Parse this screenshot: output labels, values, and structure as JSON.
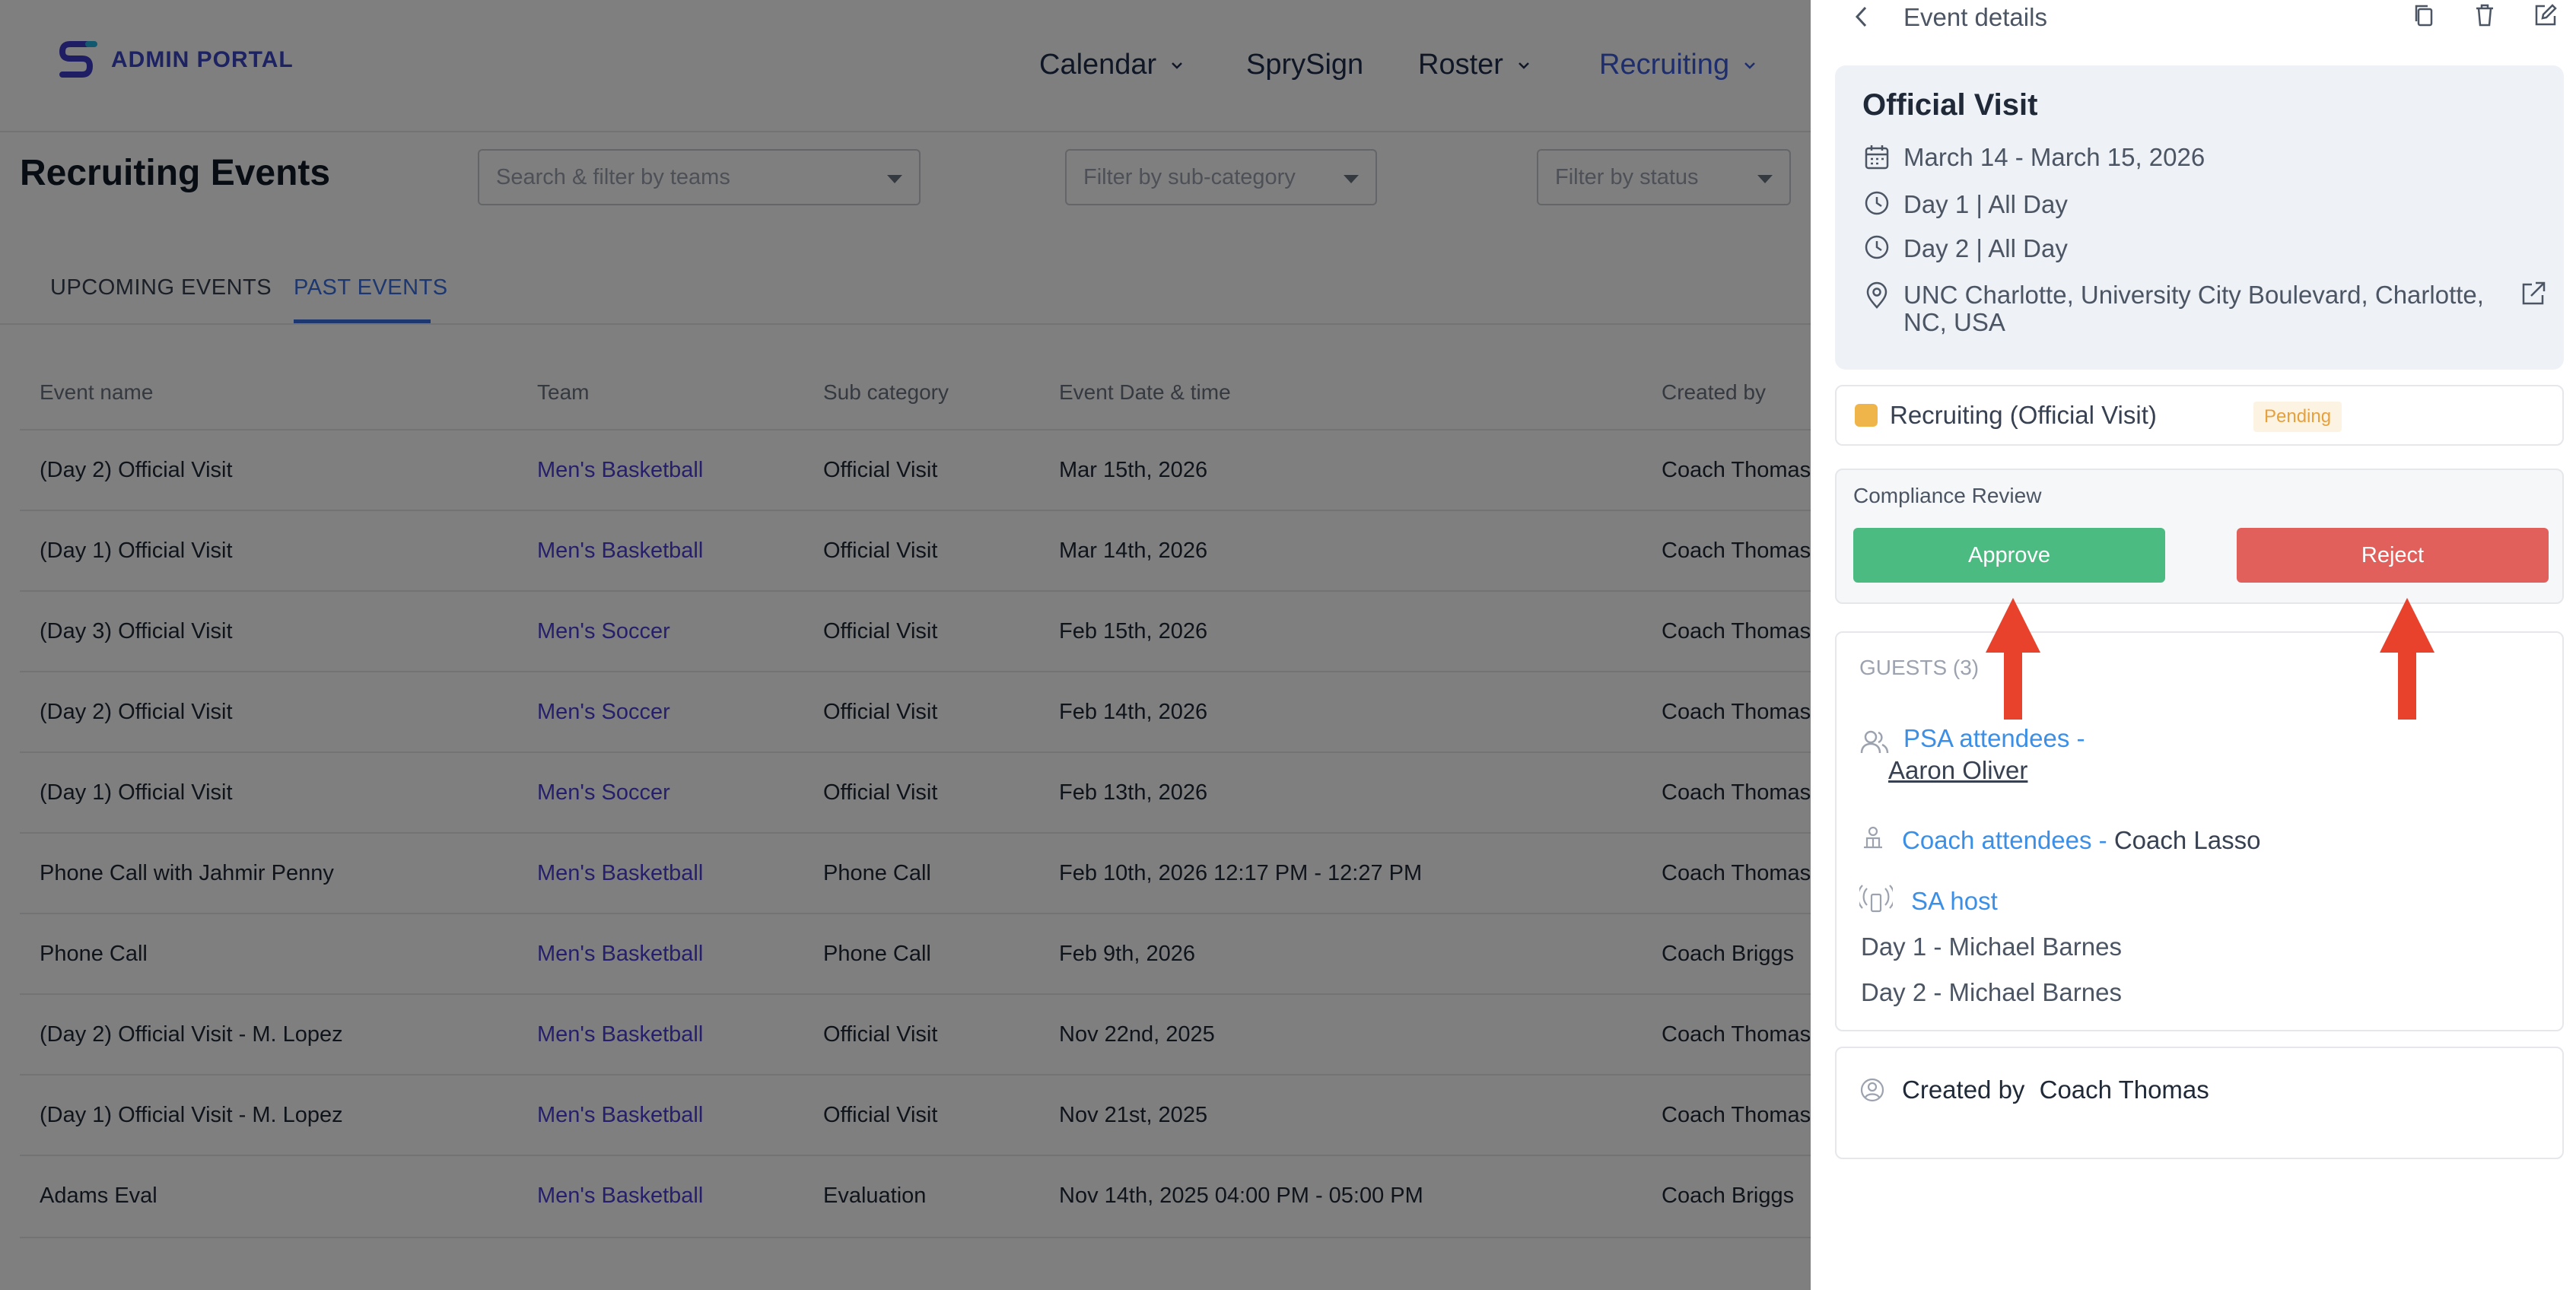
{
  "app": {
    "brand": "ADMIN PORTAL"
  },
  "nav": {
    "items": [
      {
        "label": "Calendar",
        "has_menu": true
      },
      {
        "label": "SprySign",
        "has_menu": false
      },
      {
        "label": "Roster",
        "has_menu": true
      },
      {
        "label": "Recruiting",
        "has_menu": true,
        "active": true
      }
    ]
  },
  "page": {
    "title": "Recruiting Events",
    "filters": {
      "teams_placeholder": "Search & filter by teams",
      "subcategory_placeholder": "Filter by sub-category",
      "status_placeholder": "Filter by status"
    },
    "tabs": [
      {
        "label": "UPCOMING EVENTS",
        "active": false
      },
      {
        "label": "PAST EVENTS",
        "active": true
      }
    ]
  },
  "table": {
    "headers": [
      "Event name",
      "Team",
      "Sub category",
      "Event Date & time",
      "Created by"
    ],
    "rows": [
      {
        "name": "(Day 2) Official Visit",
        "team": "Men's Basketball",
        "sub": "Official Visit",
        "date": "Mar 15th, 2026",
        "by": "Coach Thomas"
      },
      {
        "name": "(Day 1) Official Visit",
        "team": "Men's Basketball",
        "sub": "Official Visit",
        "date": "Mar 14th, 2026",
        "by": "Coach Thomas"
      },
      {
        "name": "(Day 3) Official Visit",
        "team": "Men's Soccer",
        "sub": "Official Visit",
        "date": "Feb 15th, 2026",
        "by": "Coach Thomas"
      },
      {
        "name": "(Day 2) Official Visit",
        "team": "Men's Soccer",
        "sub": "Official Visit",
        "date": "Feb 14th, 2026",
        "by": "Coach Thomas"
      },
      {
        "name": "(Day 1) Official Visit",
        "team": "Men's Soccer",
        "sub": "Official Visit",
        "date": "Feb 13th, 2026",
        "by": "Coach Thomas"
      },
      {
        "name": "Phone Call with Jahmir Penny",
        "team": "Men's Basketball",
        "sub": "Phone Call",
        "date": "Feb 10th, 2026 12:17 PM - 12:27 PM",
        "by": "Coach Thomas"
      },
      {
        "name": "Phone Call",
        "team": "Men's Basketball",
        "sub": "Phone Call",
        "date": "Feb 9th, 2026",
        "by": "Coach Briggs"
      },
      {
        "name": "(Day 2) Official Visit - M. Lopez",
        "team": "Men's Basketball",
        "sub": "Official Visit",
        "date": "Nov 22nd, 2025",
        "by": "Coach Thomas"
      },
      {
        "name": "(Day 1) Official Visit - M. Lopez",
        "team": "Men's Basketball",
        "sub": "Official Visit",
        "date": "Nov 21st, 2025",
        "by": "Coach Thomas"
      },
      {
        "name": "Adams Eval",
        "team": "Men's Basketball",
        "sub": "Evaluation",
        "date": "Nov 14th, 2025 04:00 PM - 05:00 PM",
        "by": "Coach Briggs"
      }
    ]
  },
  "panel": {
    "title": "Event details",
    "event": {
      "title": "Official Visit",
      "date_range": "March 14 - March 15, 2026",
      "day1": "Day 1 | All Day",
      "day2": "Day 2 | All Day",
      "location_line1": "UNC Charlotte, University City Boulevard, Charlotte,",
      "location_line2": "NC, USA"
    },
    "category": {
      "label": "Recruiting (Official Visit)",
      "status": "Pending",
      "color": "#f0b54a"
    },
    "compliance": {
      "label": "Compliance Review",
      "approve": "Approve",
      "reject": "Reject",
      "approve_color": "#4cbb82",
      "reject_color": "#e2605c"
    },
    "guests": {
      "header": "GUESTS (3)",
      "psa_label": "PSA attendees -",
      "psa_name": "Aaron Oliver",
      "coach_label": "Coach attendees -",
      "coach_name": "Coach Lasso",
      "sa_label": "SA host",
      "sa_day1": "Day 1 - Michael Barnes",
      "sa_day2": "Day 2 - Michael Barnes"
    },
    "created": {
      "label": "Created by",
      "name": "Coach Thomas"
    }
  },
  "icons": {
    "back": "chevron-left-icon",
    "copy": "copy-icon",
    "delete": "trash-icon",
    "edit": "edit-icon",
    "calendar": "calendar-icon",
    "clock": "clock-icon",
    "location": "map-pin-icon",
    "external": "external-link-icon"
  },
  "annotation_color": "#e8412c"
}
